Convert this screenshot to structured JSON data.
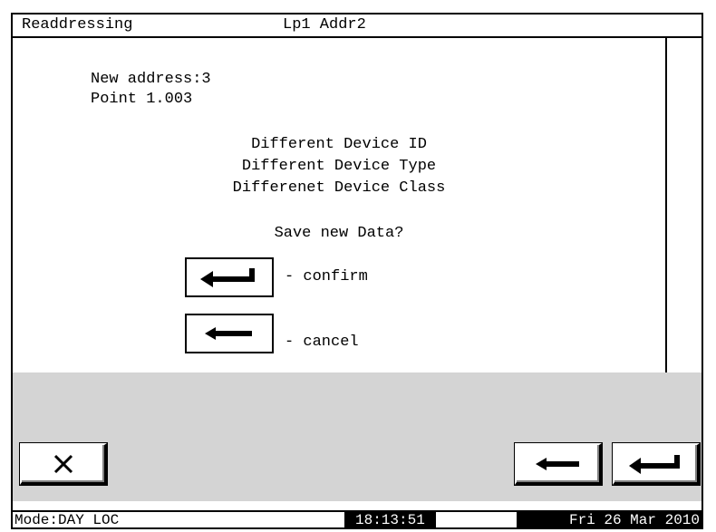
{
  "titlebar": {
    "screen_title": "Readdressing",
    "loop_address": "Lp1 Addr2"
  },
  "content": {
    "new_address": "New address:3",
    "point": "Point 1.003",
    "messages": [
      "Different Device ID",
      "Different Device Type",
      "Differenet Device Class"
    ],
    "prompt": "Save new Data?",
    "confirm_label": "- confirm",
    "cancel_label": "- cancel"
  },
  "toolbar": {
    "close_icon": "x-icon",
    "back_icon": "left-arrow-icon",
    "enter_icon": "enter-return-icon"
  },
  "statusbar": {
    "mode": "Mode:DAY LOC",
    "time": "18:13:51",
    "date": "Fri 26 Mar 2010"
  }
}
